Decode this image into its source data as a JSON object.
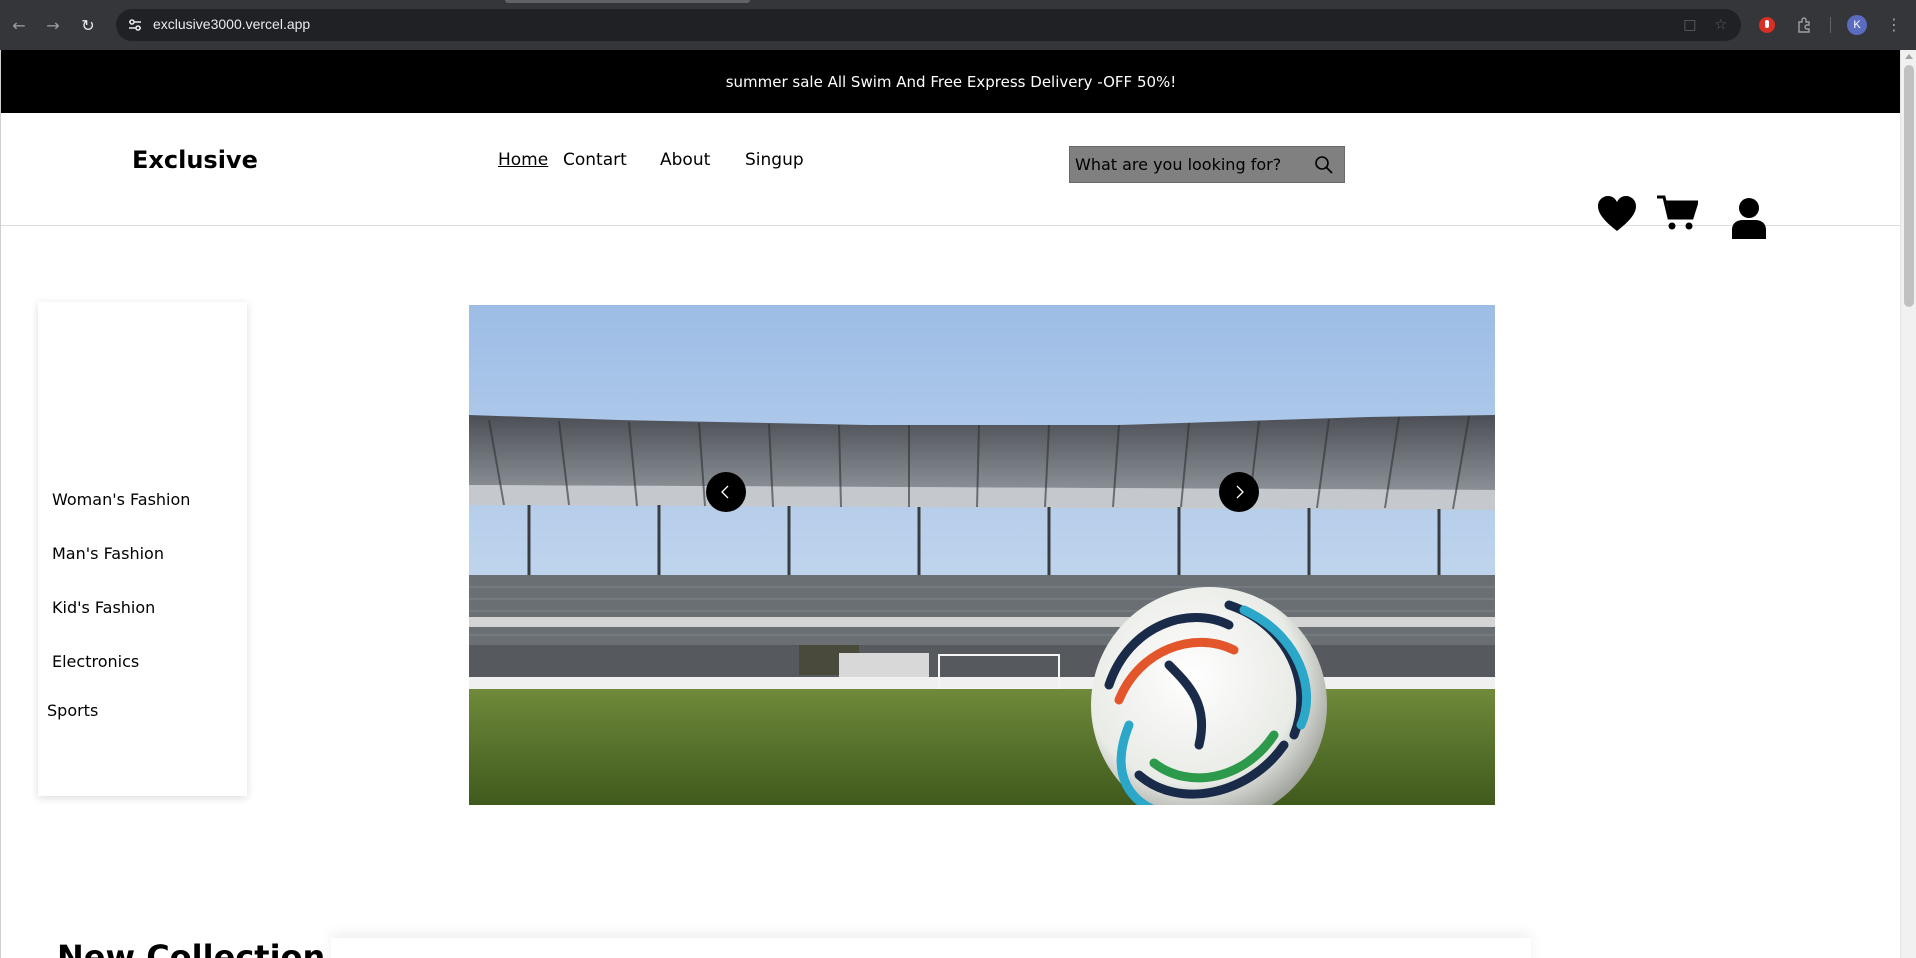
{
  "browser": {
    "url": "exclusive3000.vercel.app",
    "profile_initial": "K"
  },
  "announcement": {
    "text": "summer sale All Swim And Free Express Delivery -OFF 50%!"
  },
  "header": {
    "logo": "Exclusive",
    "nav": [
      {
        "label": "Home",
        "active": true
      },
      {
        "label": "Contart",
        "active": false
      },
      {
        "label": "About",
        "active": false
      },
      {
        "label": "Singup",
        "active": false
      }
    ],
    "search_placeholder": "What are you looking for?",
    "icons": [
      "heart-icon",
      "cart-icon",
      "user-icon"
    ]
  },
  "sidebar": {
    "categories": [
      "Woman's Fashion",
      "Man's Fashion",
      "Kid's Fashion",
      "Electronics",
      "Sports"
    ]
  },
  "hero": {
    "controls": [
      "chevron-left-icon",
      "chevron-right-icon"
    ]
  },
  "section": {
    "title": "New Collection"
  }
}
